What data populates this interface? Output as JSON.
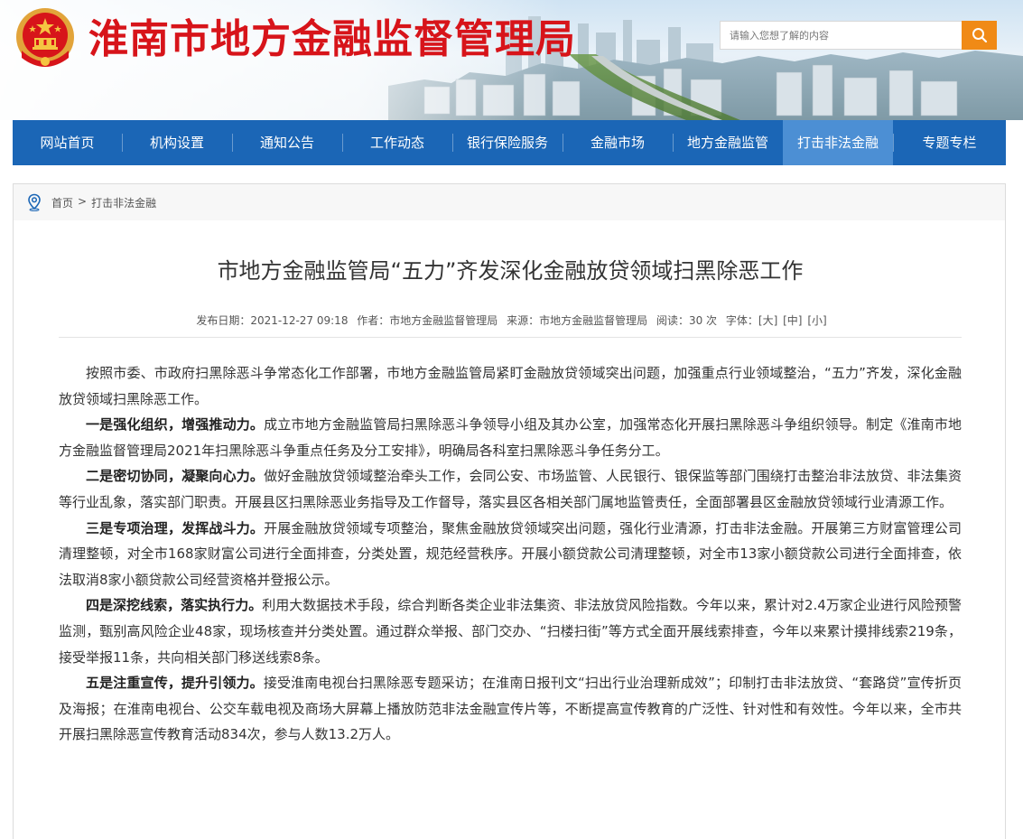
{
  "header": {
    "site_title": "淮南市地方金融监督管理局",
    "search_placeholder": "请输入您想了解的内容",
    "colors": {
      "title_red": "#d7141a",
      "search_orange": "#f08a16",
      "nav_blue": "#1b66b6",
      "nav_active": "#4c8fd4"
    }
  },
  "nav": {
    "items": [
      {
        "label": "网站首页"
      },
      {
        "label": "机构设置"
      },
      {
        "label": "通知公告"
      },
      {
        "label": "工作动态"
      },
      {
        "label": "银行保险服务"
      },
      {
        "label": "金融市场"
      },
      {
        "label": "地方金融监管"
      },
      {
        "label": "打击非法金融",
        "active": true
      },
      {
        "label": "专题专栏"
      }
    ]
  },
  "breadcrumb": {
    "icon": "location-pin-icon",
    "home": "首页",
    "separator": ">",
    "current": "打击非法金融"
  },
  "article": {
    "title": "市地方金融监管局“五力”齐发深化金融放贷领域扫黑除恶工作",
    "meta": {
      "publish": "发布日期：2021-12-27 09:18",
      "author": "作者：市地方金融监督管理局",
      "source": "来源：市地方金融监督管理局",
      "reads": "阅读：30 次",
      "font_label": "字体：",
      "font_large": "[大]",
      "font_medium": "[中]",
      "font_small": "[小]"
    },
    "paragraphs": [
      {
        "lead": "",
        "text": "按照市委、市政府扫黑除恶斗争常态化工作部署，市地方金融监管局紧盯金融放贷领域突出问题，加强重点行业领域整治，“五力”齐发，深化金融放贷领域扫黑除恶工作。"
      },
      {
        "lead": "一是强化组织，增强推动力。",
        "text": "成立市地方金融监管局扫黑除恶斗争领导小组及其办公室，加强常态化开展扫黑除恶斗争组织领导。制定《淮南市地方金融监督管理局2021年扫黑除恶斗争重点任务及分工安排》，明确局各科室扫黑除恶斗争任务分工。"
      },
      {
        "lead": "二是密切协同，凝聚向心力。",
        "text": "做好金融放贷领域整治牵头工作，会同公安、市场监管、人民银行、银保监等部门围绕打击整治非法放贷、非法集资等行业乱象，落实部门职责。开展县区扫黑除恶业务指导及工作督导，落实县区各相关部门属地监管责任，全面部署县区金融放贷领域行业清源工作。"
      },
      {
        "lead": "三是专项治理，发挥战斗力。",
        "text": "开展金融放贷领域专项整治，聚焦金融放贷领域突出问题，强化行业清源，打击非法金融。开展第三方财富管理公司清理整顿，对全市168家财富公司进行全面排查，分类处置，规范经营秩序。开展小额贷款公司清理整顿，对全市13家小额贷款公司进行全面排查，依法取消8家小额贷款公司经营资格并登报公示。"
      },
      {
        "lead": "四是深挖线索，落实执行力。",
        "text": "利用大数据技术手段，综合判断各类企业非法集资、非法放贷风险指数。今年以来，累计对2.4万家企业进行风险预警监测，甄别高风险企业48家，现场核查并分类处置。通过群众举报、部门交办、“扫楼扫街”等方式全面开展线索排查，今年以来累计摸排线索219条，接受举报11条，共向相关部门移送线索8条。"
      },
      {
        "lead": "五是注重宣传，提升引领力。",
        "text": "接受淮南电视台扫黑除恶专题采访；在淮南日报刊文“扫出行业治理新成效”；印制打击非法放贷、“套路贷”宣传折页及海报；在淮南电视台、公交车载电视及商场大屏幕上播放防范非法金融宣传片等，不断提高宣传教育的广泛性、针对性和有效性。今年以来，全市共开展扫黑除恶宣传教育活动834次，参与人数13.2万人。"
      }
    ]
  }
}
